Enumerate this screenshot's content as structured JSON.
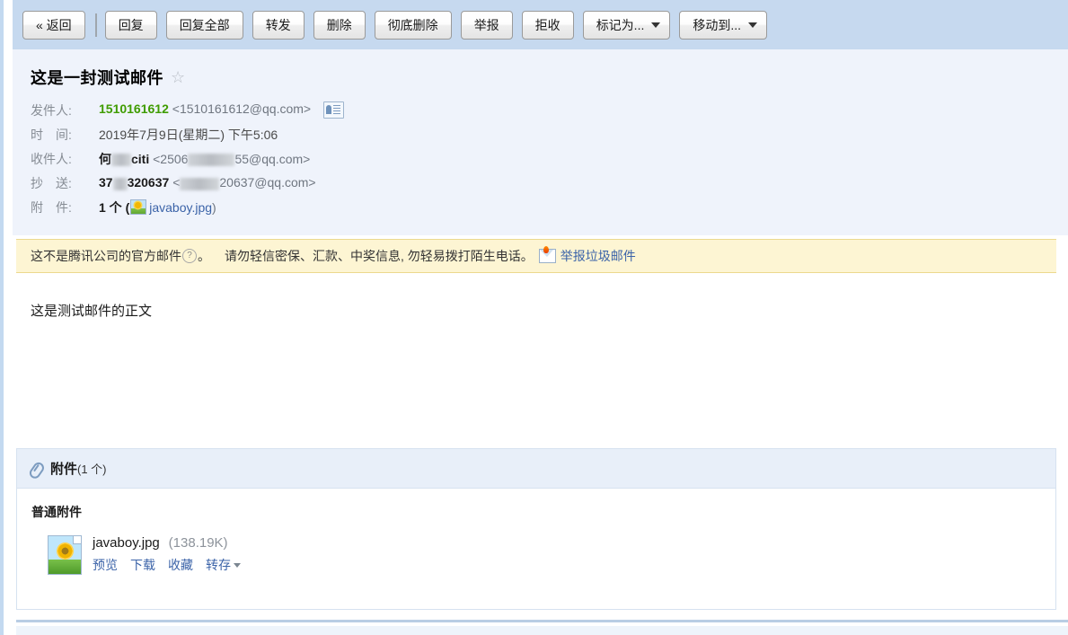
{
  "toolbar": {
    "buttons": [
      {
        "label": "« 返回",
        "caret": false
      },
      {
        "label": "回复",
        "caret": false
      },
      {
        "label": "回复全部",
        "caret": false
      },
      {
        "label": "转发",
        "caret": false
      },
      {
        "label": "删除",
        "caret": false
      },
      {
        "label": "彻底删除",
        "caret": false
      },
      {
        "label": "举报",
        "caret": false
      },
      {
        "label": "拒收",
        "caret": false
      },
      {
        "label": "标记为...",
        "caret": true
      },
      {
        "label": "移动到...",
        "caret": true
      }
    ]
  },
  "mail": {
    "subject": "这是一封测试邮件",
    "star_glyph": "☆",
    "labels": {
      "from": "发件人:",
      "date_a": "时",
      "date_b": "间:",
      "to": "收件人:",
      "cc_a": "抄",
      "cc_b": "送:",
      "attach_a": "附",
      "attach_b": "件:"
    },
    "from_name": "1510161612",
    "from_address": "<1510161612@qq.com>",
    "date": "2019年7月9日(星期二) 下午5:06",
    "to_name_visible": "何",
    "to_name_tail": "citi",
    "to_address_prefix": "<2506",
    "to_address_suffix": "55@qq.com>",
    "cc_name_prefix": "37",
    "cc_name_suffix": "320637",
    "cc_address_prefix": "<",
    "cc_address_suffix": "20637@qq.com>",
    "attach_count_text": "1 个 (",
    "attach_file_link": "javaboy.jpg",
    "attach_close": ")"
  },
  "warning": {
    "text_before": "这不是腾讯公司的官方邮件",
    "question_mark": "?",
    "text_period": "。",
    "text_after": "请勿轻信密保、汇款、中奖信息, 勿轻易拨打陌生电话。",
    "report_link": "举报垃圾邮件"
  },
  "body": {
    "text": "这是测试邮件的正文"
  },
  "attachments": {
    "header_title": "附件",
    "header_count": "(1 个)",
    "section_title": "普通附件",
    "items": [
      {
        "name": "javaboy.jpg",
        "size": "(138.19K)",
        "links": [
          "预览",
          "下载",
          "收藏",
          "转存"
        ]
      }
    ]
  },
  "colors": {
    "toolbar_bg": "#c6d9ef",
    "header_bg": "#eff3fb",
    "warning_bg": "#fdf5d3",
    "link_blue": "#3b63a8",
    "sender_green": "#3f9c00"
  }
}
